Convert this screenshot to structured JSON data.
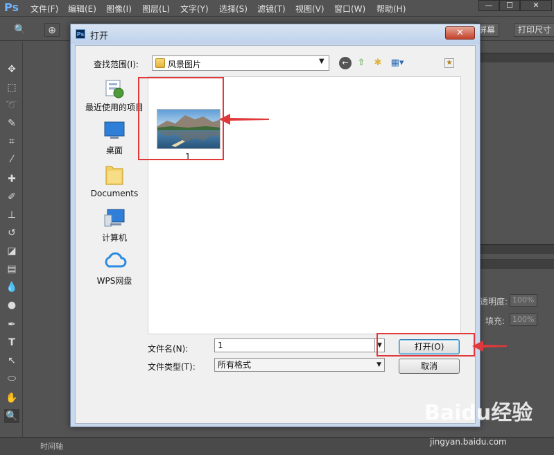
{
  "ps": {
    "logo": "Ps",
    "menu": [
      "文件(F)",
      "编辑(E)",
      "图像(I)",
      "图层(L)",
      "文字(Y)",
      "选择(S)",
      "滤镜(T)",
      "视图(V)",
      "窗口(W)",
      "帮助(H)"
    ],
    "window_buttons": [
      "—",
      "☐",
      "✕"
    ],
    "options": {
      "fullscreen_btn": "屏幕",
      "print_size_btn": "打印尺寸"
    },
    "right_panel": {
      "opacity_label": "透明度:",
      "opacity_value": "100%",
      "fill_label": "填充:",
      "fill_value": "100%"
    },
    "timeline_label": "时间轴"
  },
  "dialog": {
    "title": "打开",
    "close_glyph": "✕",
    "look_in_label": "查找范围(I):",
    "look_in_value": "风景图片",
    "places": [
      {
        "label": "最近使用的项目",
        "icon": "recent-items-icon"
      },
      {
        "label": "桌面",
        "icon": "desktop-icon"
      },
      {
        "label": "Documents",
        "icon": "documents-folder-icon"
      },
      {
        "label": "计算机",
        "icon": "computer-icon"
      },
      {
        "label": "WPS网盘",
        "icon": "wps-cloud-icon"
      }
    ],
    "files": [
      {
        "name": "1"
      }
    ],
    "filename_label": "文件名(N):",
    "filename_value": "1",
    "filetype_label": "文件类型(T):",
    "filetype_value": "所有格式",
    "open_button": "打开(O)",
    "cancel_button": "取消"
  },
  "watermark": {
    "main": "Baidu经验",
    "sub": "jingyan.baidu.com"
  },
  "colors": {
    "annotation_red": "#e0393b",
    "ps_bg": "#535353",
    "dialog_frame": "#c9d8ec"
  }
}
